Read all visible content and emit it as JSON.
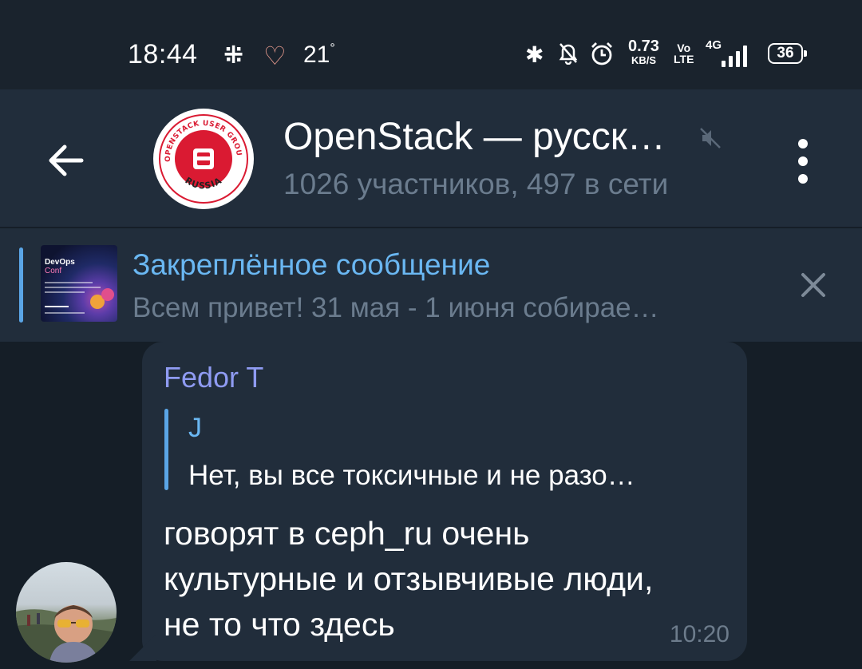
{
  "status_bar": {
    "time": "18:44",
    "slack_icon": "slack-icon",
    "health_icon": "heart-pulse-icon",
    "temperature": "21",
    "temperature_unit": "°",
    "bluetooth_icon": "bluetooth-icon",
    "mute_icon": "bell-off-icon",
    "alarm_icon": "alarm-icon",
    "net_speed": "0.73",
    "net_speed_unit": "KB/S",
    "volte_top": "Vo",
    "volte_bottom": "LTE",
    "network_type": "4G",
    "battery": "36"
  },
  "header": {
    "title": "OpenStack — русск…",
    "subtitle": "1026 участников, 497 в сети",
    "avatar_top_text": "OPENSTACK USER GROUP",
    "avatar_bottom_text": "RUSSIA",
    "back_icon": "arrow-left-icon",
    "mute_icon": "muted-speaker-icon",
    "menu_icon": "more-vertical-icon",
    "brand_color": "#da1a32"
  },
  "pinned": {
    "title": "Закреплённое сообщение",
    "text": "Всем привет! 31 мая - 1 июня собирае…",
    "thumb_title": "DevOps",
    "thumb_subtitle": "Conf",
    "close_icon": "close-icon"
  },
  "message": {
    "sender": "Fedor T",
    "reply_author": "J",
    "reply_text": "Нет, вы все токсичные и не разо…",
    "text": "говорят в ceph_ru очень культурные и отзывчивые люди, не то что здесь",
    "time": "10:20"
  },
  "colors": {
    "background": "#151e27",
    "panel": "#212d3b",
    "accent": "#6ab7f2",
    "sender_name": "#8f9bf2",
    "muted_text": "#6b7c8e"
  }
}
